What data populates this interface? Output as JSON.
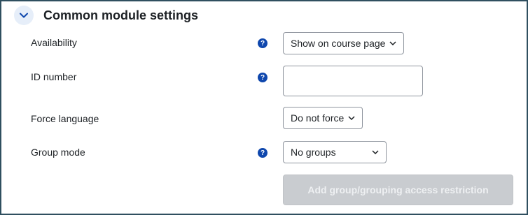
{
  "section": {
    "title": "Common module settings",
    "collapse_icon": "chevron-down-icon"
  },
  "colors": {
    "accent": "#0f47ad",
    "collapse_bg": "#e6eef9",
    "frame_border": "#2f4f5f",
    "disabled_button_bg": "#c9ccd0"
  },
  "fields": {
    "availability": {
      "label": "Availability",
      "help": "?",
      "value": "Show on course page"
    },
    "id_number": {
      "label": "ID number",
      "help": "?",
      "value": ""
    },
    "force_language": {
      "label": "Force language",
      "value": "Do not force"
    },
    "group_mode": {
      "label": "Group mode",
      "help": "?",
      "value": "No groups"
    }
  },
  "buttons": {
    "add_restriction": "Add group/grouping access restriction"
  }
}
